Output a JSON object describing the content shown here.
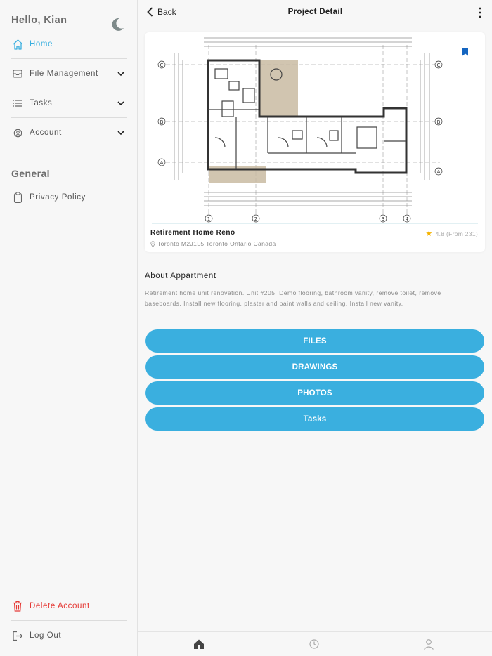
{
  "sidebar": {
    "greeting": "Hello, Kian",
    "theme_icon": "moon-icon",
    "items": [
      {
        "label": "Home",
        "icon": "home-icon",
        "active": true
      },
      {
        "label": "File Management",
        "icon": "inbox-icon"
      },
      {
        "label": "Tasks",
        "icon": "list-icon"
      },
      {
        "label": "Account",
        "icon": "account-icon"
      }
    ],
    "section_general": "General",
    "privacy_label": "Privacy Policy",
    "delete_label": "Delete Account",
    "logout_label": "Log Out"
  },
  "header": {
    "back_label": "Back",
    "title": "Project Detail"
  },
  "project": {
    "name": "Retirement Home Reno",
    "rating": "4.8",
    "reviews": "(From 231)",
    "address": "Toronto M2J1L5 Toronto Ontario Canada",
    "about_title": "About Appartment",
    "about_text": "Retirement home unit renovation. Unit #205. Demo flooring, bathroom vanity, remove toilet, remove baseboards.  Install new flooring, plaster and paint walls and ceiling. Install new vanity.",
    "plan_axis_labels": [
      "C",
      "B",
      "A",
      "1",
      "2",
      "3",
      "4"
    ]
  },
  "actions": {
    "files": "FILES",
    "drawings": "DRAWINGS",
    "photos": "PHOTOS",
    "tasks": "Tasks"
  },
  "colors": {
    "accent": "#3aafdf",
    "danger": "#e53935",
    "active_nav": "#3aafdf",
    "bookmark": "#1565c0"
  },
  "tabbar": [
    "home-icon",
    "clock-icon",
    "profile-icon"
  ]
}
